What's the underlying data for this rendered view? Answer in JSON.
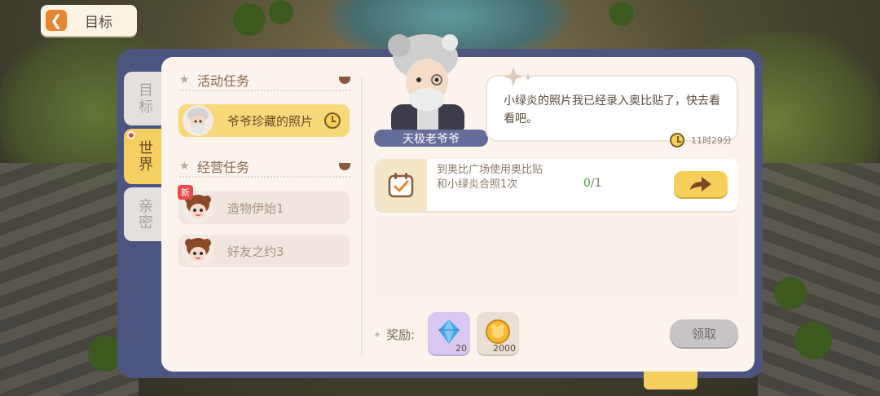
{
  "header": {
    "back_label": "目标"
  },
  "side_tabs": [
    {
      "id": "goal",
      "label": "目标"
    },
    {
      "id": "world",
      "label": "世界",
      "active": true,
      "has_notification": true
    },
    {
      "id": "intimacy",
      "label": "亲密"
    }
  ],
  "quest_list": {
    "activity_section_title": "活动任务",
    "activity_quests": [
      {
        "label": "爷爷珍藏的照片",
        "active": true,
        "timed": true
      }
    ],
    "business_section_title": "经营任务",
    "business_quests": [
      {
        "label": "造物伊始1",
        "badge": "新"
      },
      {
        "label": "好友之约3"
      }
    ]
  },
  "npc": {
    "name": "天极老爷爷",
    "dialog": "小绿炎的照片我已经录入奥比贴了，快去看看吧。",
    "time_left": "11时29分"
  },
  "objective": {
    "description": "到奥比广场使用奥比贴和小绿炎合照1次",
    "current": "0",
    "separator": "/",
    "total": "1"
  },
  "rewards": {
    "label": "奖励:",
    "items": [
      {
        "icon": "crystal-icon",
        "count": "20"
      },
      {
        "icon": "coin-icon",
        "count": "2000"
      }
    ],
    "claim_label": "领取"
  },
  "colors": {
    "frame": "#4c5580",
    "panel": "#fbf3ec",
    "accent_yellow": "#f6cf5b",
    "accent_orange": "#e7862f",
    "notification_red": "#e84545",
    "progress_green": "#4aab3a"
  }
}
